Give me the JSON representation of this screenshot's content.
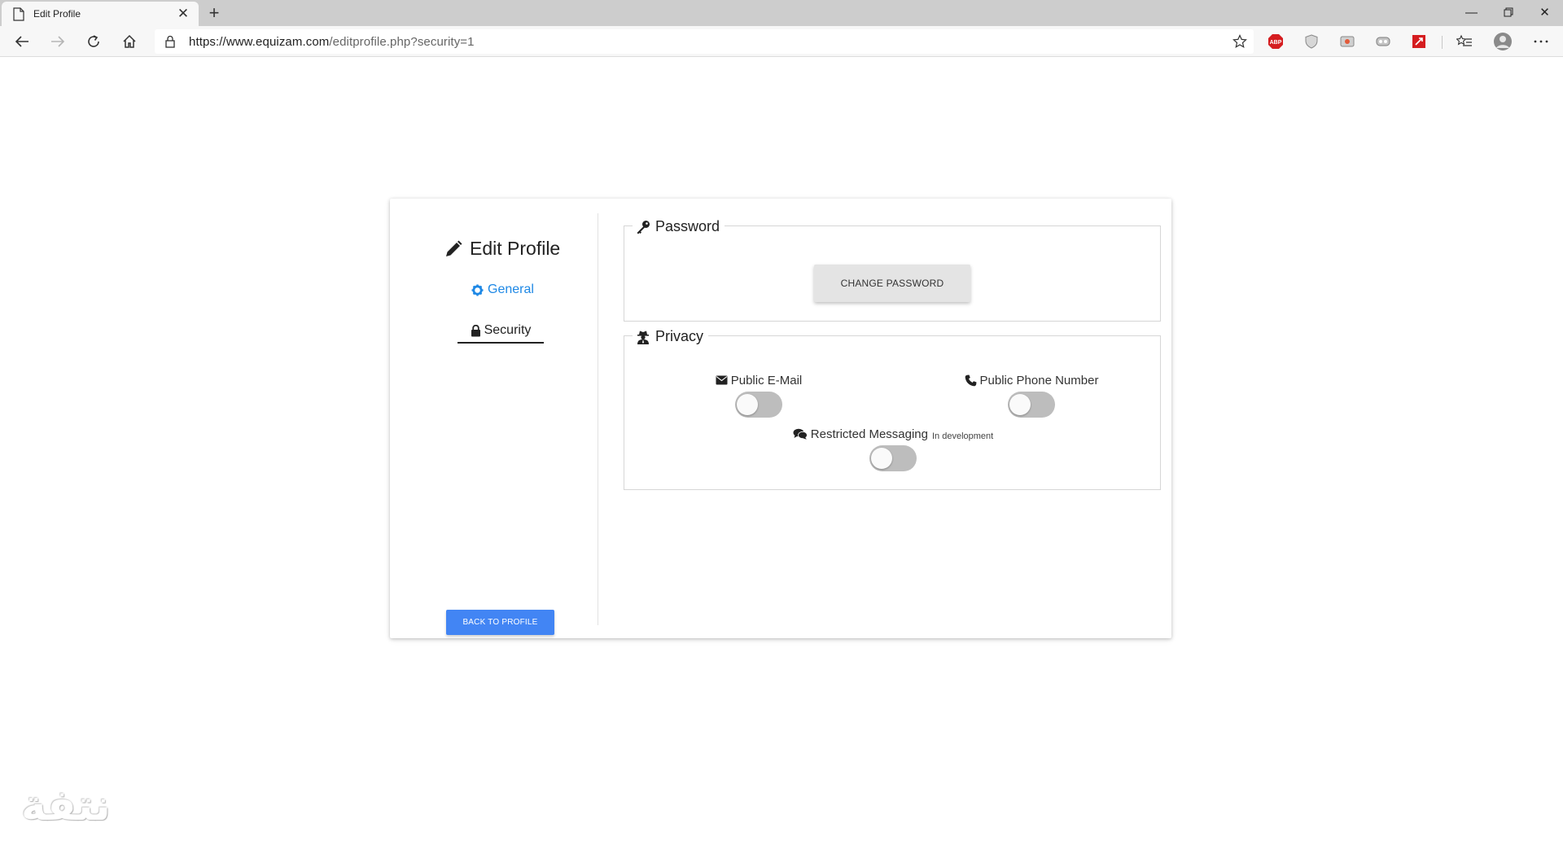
{
  "browser": {
    "tab_title": "Edit Profile",
    "url_host": "https://www.equizam.com",
    "url_path": "/editprofile.php?security=1"
  },
  "sidebar": {
    "title": "Edit Profile",
    "items": [
      {
        "label": "General",
        "active": false
      },
      {
        "label": "Security",
        "active": true
      }
    ],
    "back_button": "BACK TO PROFILE"
  },
  "password": {
    "legend": "Password",
    "button": "CHANGE PASSWORD"
  },
  "privacy": {
    "legend": "Privacy",
    "toggles": [
      {
        "label": "Public E-Mail",
        "icon": "envelope-icon",
        "checked": false
      },
      {
        "label": "Public Phone Number",
        "icon": "phone-icon",
        "checked": false
      },
      {
        "label": "Restricted Messaging",
        "note": "In development",
        "icon": "comments-icon",
        "checked": false
      }
    ]
  },
  "watermark": "ﻧﺘﻔﺔ",
  "colors": {
    "accent": "#1e88e5",
    "button_blue": "#4285f4"
  }
}
